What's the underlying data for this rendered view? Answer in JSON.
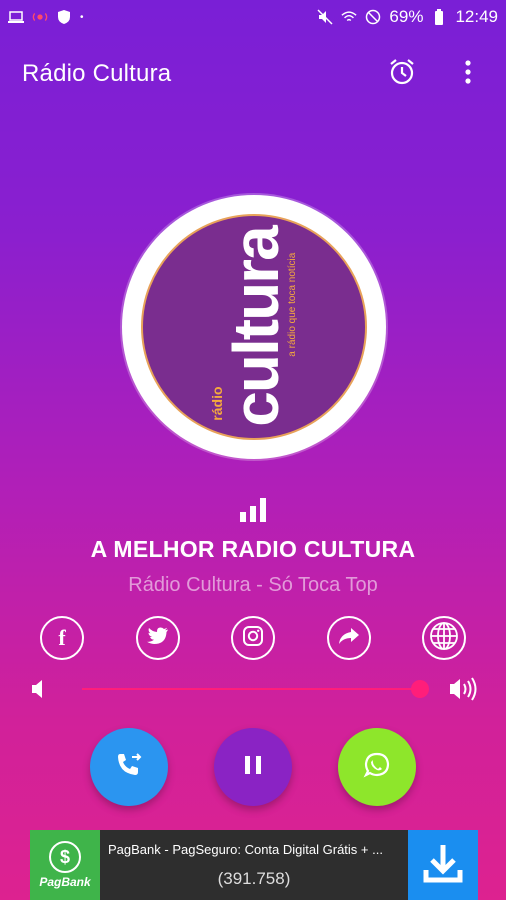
{
  "status": {
    "battery": "69%",
    "time": "12:49"
  },
  "toolbar": {
    "title": "Rádio Cultura"
  },
  "logo": {
    "radio": "rádio",
    "cultura": "cultura",
    "tagline": "a rádio que toca notícia"
  },
  "now_playing": {
    "title": "A MELHOR RADIO CULTURA",
    "subtitle": "Rádio Cultura - Só Toca Top"
  },
  "social": [
    {
      "name": "facebook-icon",
      "glyph": "f"
    },
    {
      "name": "twitter-icon"
    },
    {
      "name": "instagram-icon"
    },
    {
      "name": "share-icon"
    },
    {
      "name": "globe-icon"
    }
  ],
  "volume": {
    "level": 1.0
  },
  "ad": {
    "brand": "PagBank",
    "logo_symbol": "$",
    "title": "PagBank - PagSeguro: Conta Digital Grátis + ...",
    "count": "(391.758)"
  },
  "colors": {
    "call": "#2b95f0",
    "pause": "#8a23c4",
    "whatsapp": "#8ee62b",
    "ad_download": "#1a8ef0",
    "accent": "#ff1e7a"
  }
}
